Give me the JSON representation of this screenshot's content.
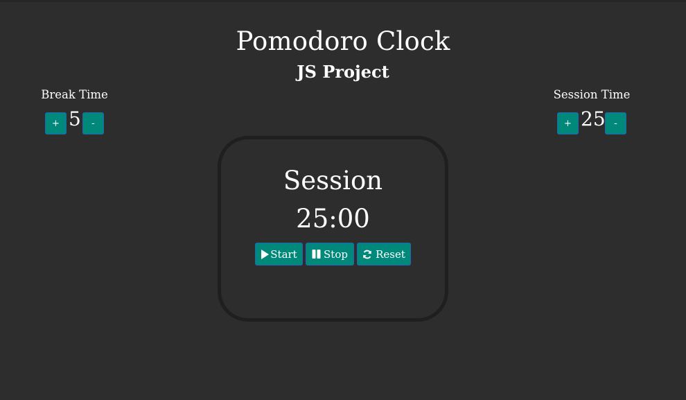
{
  "header": {
    "title": "Pomodoro Clock",
    "subtitle": "JS Project"
  },
  "break": {
    "label": "Break Time",
    "value": "5",
    "increment_label": "+",
    "decrement_label": "-"
  },
  "session": {
    "label": "Session Time",
    "value": "25",
    "increment_label": "+",
    "decrement_label": "-"
  },
  "clock": {
    "mode_label": "Session",
    "time": "25:00"
  },
  "controls": {
    "start_label": "Start",
    "stop_label": "Stop",
    "reset_label": "Reset",
    "start_icon": "play-icon",
    "stop_icon": "pause-icon",
    "reset_icon": "refresh-icon"
  },
  "colors": {
    "background": "#2d2d2d",
    "button": "#00897b",
    "button_border": "#2167b8",
    "clock_border": "#1f1f1f",
    "text": "#ffffff"
  }
}
